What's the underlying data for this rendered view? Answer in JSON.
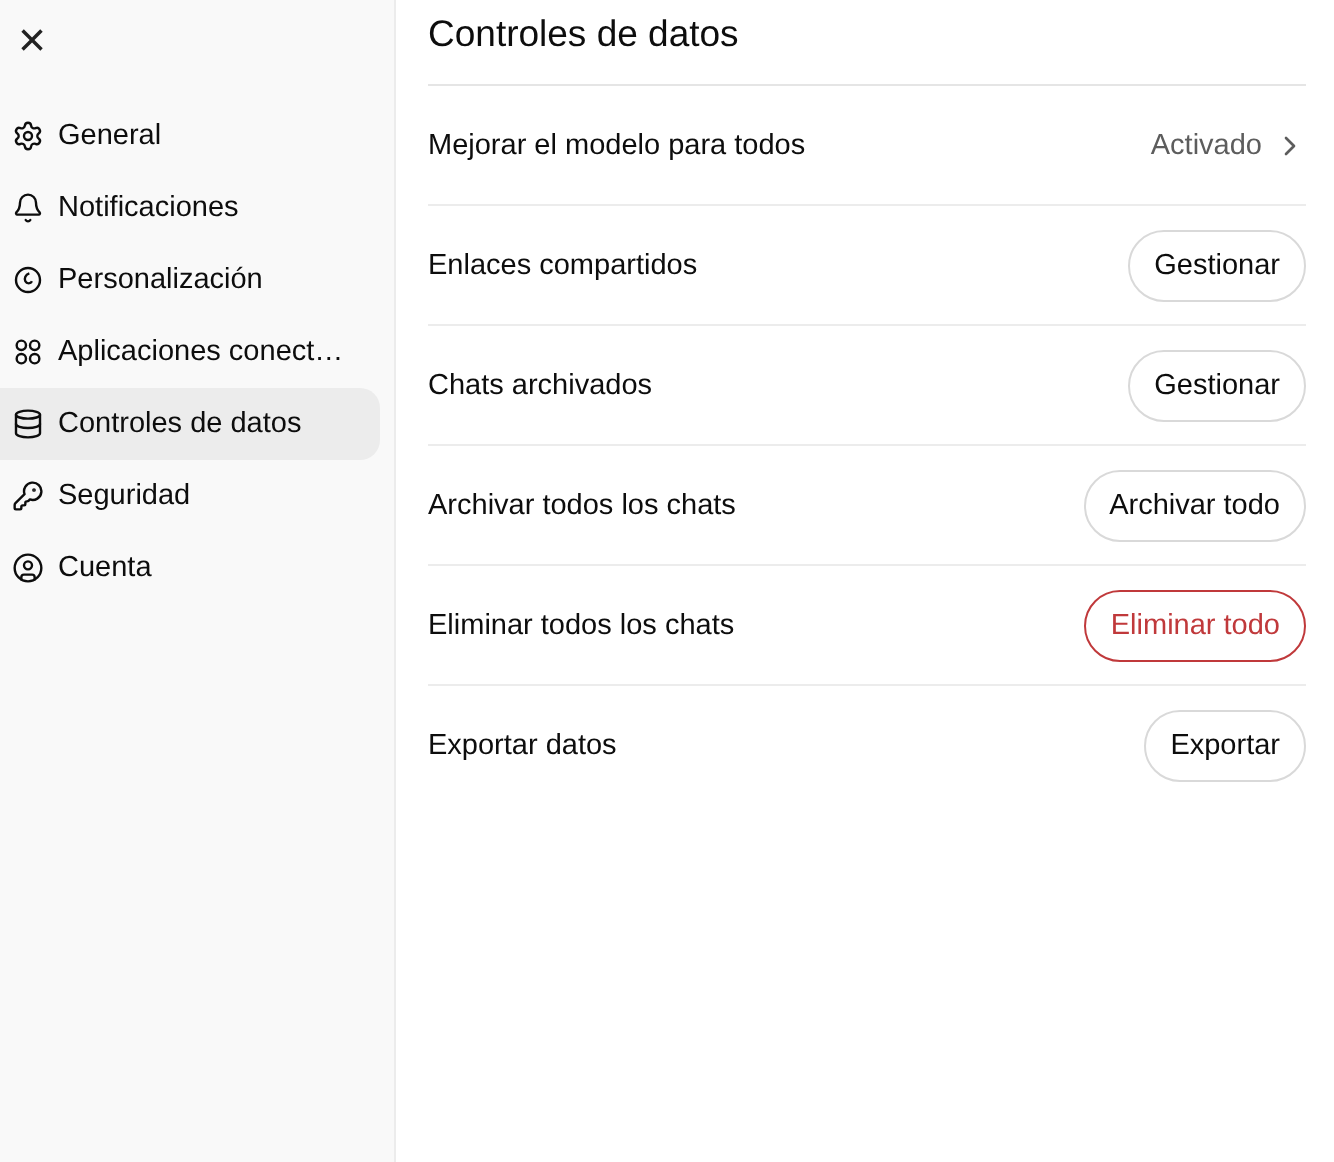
{
  "sidebar": {
    "close": "×",
    "items": [
      {
        "label": "General",
        "selected": false
      },
      {
        "label": "Notificaciones",
        "selected": false
      },
      {
        "label": "Personalización",
        "selected": false
      },
      {
        "label": "Aplicaciones conect…",
        "selected": false
      },
      {
        "label": "Controles de datos",
        "selected": true
      },
      {
        "label": "Seguridad",
        "selected": false
      },
      {
        "label": "Cuenta",
        "selected": false
      }
    ]
  },
  "main": {
    "title": "Controles de datos",
    "rows": [
      {
        "kind": "link",
        "label": "Mejorar el modelo para todos",
        "value": "Activado"
      },
      {
        "kind": "button",
        "label": "Enlaces compartidos",
        "button": "Gestionar",
        "danger": false
      },
      {
        "kind": "button",
        "label": "Chats archivados",
        "button": "Gestionar",
        "danger": false
      },
      {
        "kind": "button",
        "label": "Archivar todos los chats",
        "button": "Archivar todo",
        "danger": false
      },
      {
        "kind": "button",
        "label": "Eliminar todos los chats",
        "button": "Eliminar todo",
        "danger": true
      },
      {
        "kind": "button",
        "label": "Exportar datos",
        "button": "Exportar",
        "danger": false
      }
    ]
  }
}
